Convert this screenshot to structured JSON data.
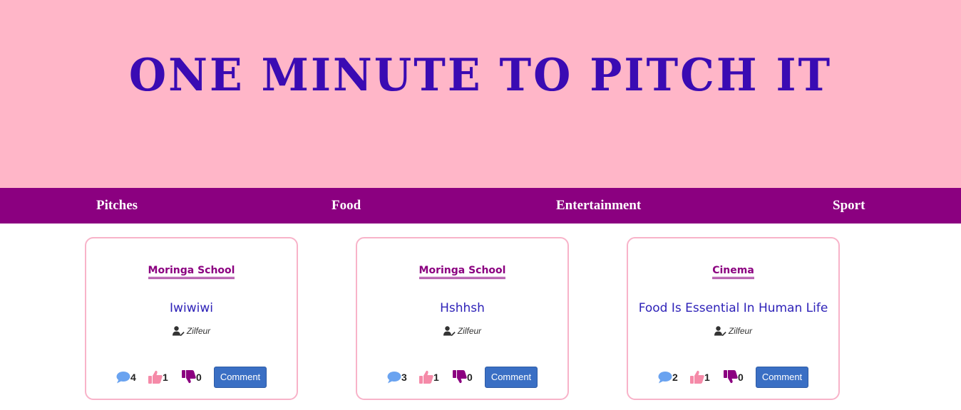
{
  "header": {
    "title": "ONE MINUTE TO PITCH IT"
  },
  "nav": {
    "items": [
      "Pitches",
      "Food",
      "Entertainment",
      "Sport"
    ]
  },
  "colors": {
    "hero_bg": "#ffb6c8",
    "title": "#3a0bb3",
    "nav_bg": "#8b0080",
    "card_border": "#f8b3c9",
    "button": "#3a6fc4",
    "comment_icon": "#6aa3f0",
    "upvote_icon": "#f58aa8",
    "downvote_icon": "#8b0080"
  },
  "icons": {
    "comment": "comment-icon",
    "upvote": "thumbs-up-icon",
    "downvote": "thumbs-down-icon",
    "author": "user-edit-icon"
  },
  "pitches": [
    {
      "category": "Moringa School",
      "title": "Iwiwiwi",
      "author": "Zilfeur",
      "comments": "4",
      "upvotes": "1",
      "downvotes": "0",
      "button": "Comment"
    },
    {
      "category": "Moringa School",
      "title": "Hshhsh",
      "author": "Zilfeur",
      "comments": "3",
      "upvotes": "1",
      "downvotes": "0",
      "button": "Comment"
    },
    {
      "category": "Cinema",
      "title": "Food Is Essential In Human Life",
      "author": "Zilfeur",
      "comments": "2",
      "upvotes": "1",
      "downvotes": "0",
      "button": "Comment"
    }
  ]
}
